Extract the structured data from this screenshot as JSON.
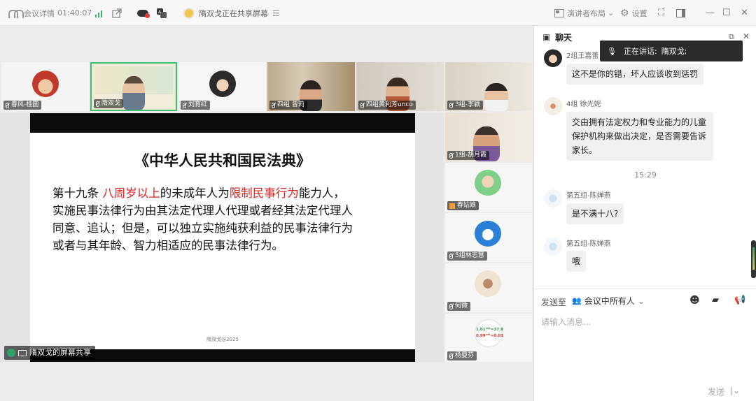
{
  "topbar": {
    "meeting_details": "会议详情",
    "timer": "01:40:07",
    "sharing_notice": "隋双戈正在共享屏幕",
    "layout_label": "演讲者布局",
    "settings_label": "设置"
  },
  "participants": [
    {
      "name": "春风-桂圆"
    },
    {
      "name": "隋双戈"
    },
    {
      "name": "刘育红"
    },
    {
      "name": "四组 曾莉"
    },
    {
      "name": "四组黄利芳unco"
    },
    {
      "name": "3组-李颖"
    },
    {
      "name": "1组-胡月霞"
    },
    {
      "name": "春姑娘"
    },
    {
      "name": "5组林志慧"
    },
    {
      "name": "何微"
    },
    {
      "name": "杨曼芬"
    }
  ],
  "thumb_overlay": {
    "line1": "1.01³⁶⁵=37.8",
    "line2": "0.99³⁶⁵=0.03"
  },
  "slide": {
    "title": "《中华人民共和国民法典》",
    "line1_a": "第十九条   ",
    "line1_b": "八周岁以上",
    "line1_c": "的未成年人为",
    "line1_d": "限制民事行为",
    "line1_e": "能力人，",
    "line2": "实施民事法律行为由其法定代理人代理或者经其法定代理人",
    "line3": "同意、追认；但是，可以独立实施纯获利益的民事法律行为",
    "line4": "或者与其年龄、智力相适应的民事法律行为。",
    "footer": "隋双戈@2025"
  },
  "share_label": "隋双戈的屏幕共享",
  "speaking": {
    "label": "正在讲话:",
    "name": "隋双戈;"
  },
  "chat": {
    "title": "聊天",
    "messages": [
      {
        "sender": "2组王嘉蕾",
        "text": "这不是你的错，坏人应该收到惩罚"
      },
      {
        "sender": "4组 徐光妮",
        "text_l1": "交由拥有法定权力和专业能力的儿童",
        "text_l2": "保护机构来做出决定，是否需要告诉",
        "text_l3": "家长。"
      },
      {
        "sender": "第五组-陈婵燕",
        "text": "是不满十八?"
      },
      {
        "sender": "第五组-陈婵燕",
        "text": "哦"
      }
    ],
    "time_separator": "15:29",
    "send_to_label": "发送至",
    "send_to_target": "会议中所有人",
    "input_placeholder": "请输入消息...",
    "send_button": "发送"
  },
  "colors": {
    "accent_red": "#e0201c",
    "speaker_border": "#3cc06b"
  }
}
